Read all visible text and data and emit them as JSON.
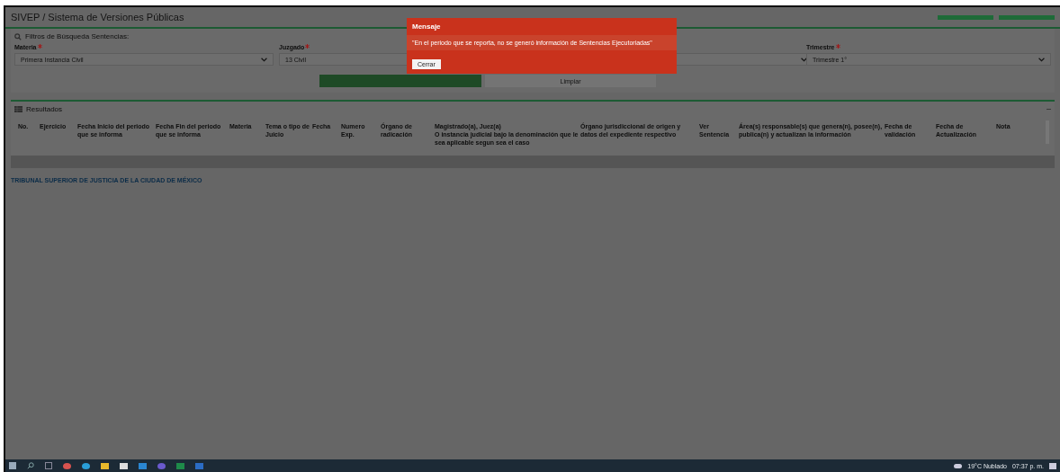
{
  "header": {
    "title": "SIVEP / Sistema de Versiones Públicas"
  },
  "filters": {
    "title": "Filtros de Búsqueda Sentencias:",
    "fields": [
      {
        "label": "Materia",
        "required": true,
        "value": "Primera Instancia Civil"
      },
      {
        "label": "Juzgado",
        "required": true,
        "value": "13 Civil"
      },
      {
        "label": "Trimestre",
        "required": true,
        "value": "Trimestre 1°"
      }
    ],
    "clear_button": "Limpiar"
  },
  "results": {
    "title": "Resultados",
    "columns": [
      "No.",
      "Ejercicio",
      "Fecha Inicio del periodo que se informa",
      "Fecha Fin del periodo que se informa",
      "Materia",
      "Tema o tipo de Juicio",
      "Fecha",
      "Numero Exp.",
      "Órgano de radicación",
      "Magistrado(a), Juez(a)\nO instancia judicial bajo la denominación que le sea aplicable segun sea el caso",
      "Órgano jurisdiccional de origen y datos del expediente respectivo",
      "Ver Sentencia",
      "Área(s) responsable(s) que genera(n), posee(n), publica(n) y actualizan la información",
      "Fecha de validación",
      "Fecha de Actualización",
      "Nota"
    ]
  },
  "footer": {
    "text": "TRIBUNAL SUPERIOR DE JUSTICIA DE LA CIUDAD DE MÉXICO"
  },
  "dialog": {
    "title": "Mensaje",
    "message": "\"En el periodo que se reporta, no se generó información de Sentencias Ejecutoriadas\"",
    "button": "Cerrar"
  },
  "taskbar": {
    "weather": "19°C Nublado",
    "time": "07:37 p. m."
  }
}
